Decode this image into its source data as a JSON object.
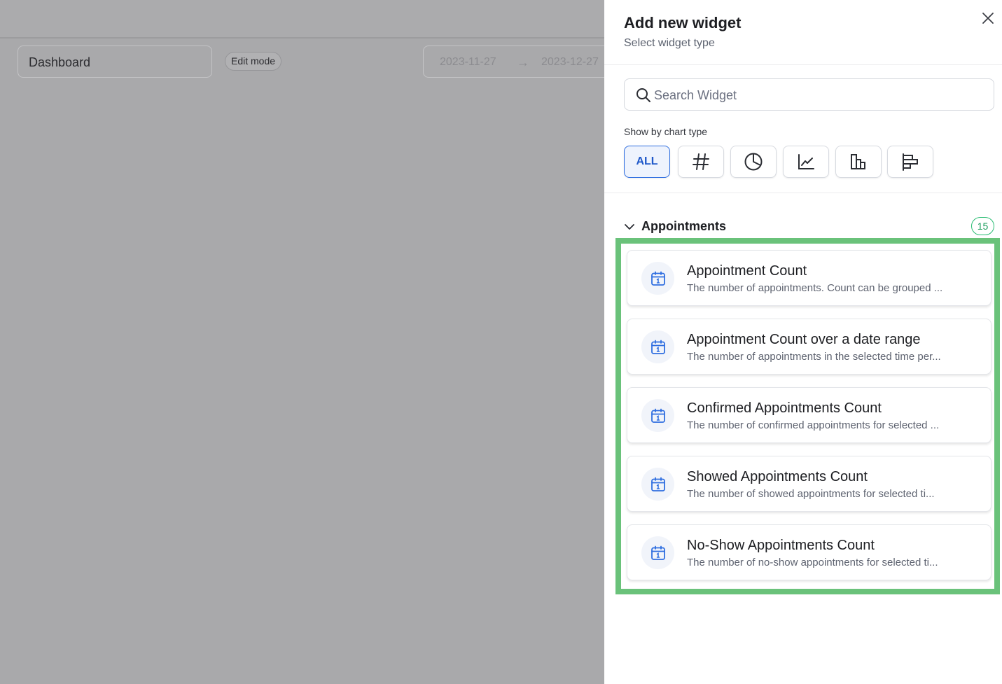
{
  "background": {
    "dashboard_name": "Dashboard",
    "edit_mode_label": "Edit mode",
    "date_start": "2023-11-27",
    "date_arrow": "→",
    "date_end": "2023-12-27"
  },
  "panel": {
    "title": "Add new widget",
    "subtitle": "Select widget type",
    "close_icon": "close-icon",
    "search": {
      "placeholder": "Search Widget",
      "value": ""
    },
    "chart_type_label": "Show by chart type",
    "chart_types": [
      {
        "label": "ALL",
        "active": true
      },
      {
        "icon": "hash-icon"
      },
      {
        "icon": "pie-chart-icon"
      },
      {
        "icon": "line-chart-icon"
      },
      {
        "icon": "bar-chart-icon"
      },
      {
        "icon": "horizontal-bar-chart-icon"
      }
    ],
    "section": {
      "title": "Appointments",
      "count": "15",
      "items": [
        {
          "title": "Appointment Count",
          "description": "The number of appointments. Count can be grouped ..."
        },
        {
          "title": "Appointment Count over a date range",
          "description": "The number of appointments in the selected time per..."
        },
        {
          "title": "Confirmed Appointments Count",
          "description": "The number of confirmed appointments for selected ..."
        },
        {
          "title": "Showed Appointments Count",
          "description": "The number of showed appointments for selected ti..."
        },
        {
          "title": "No-Show Appointments Count",
          "description": "The number of no-show appointments for selected ti..."
        }
      ]
    }
  },
  "colors": {
    "accent": "#1f58c9",
    "highlight": "#6ac27a",
    "badge": "#2bbd74"
  }
}
